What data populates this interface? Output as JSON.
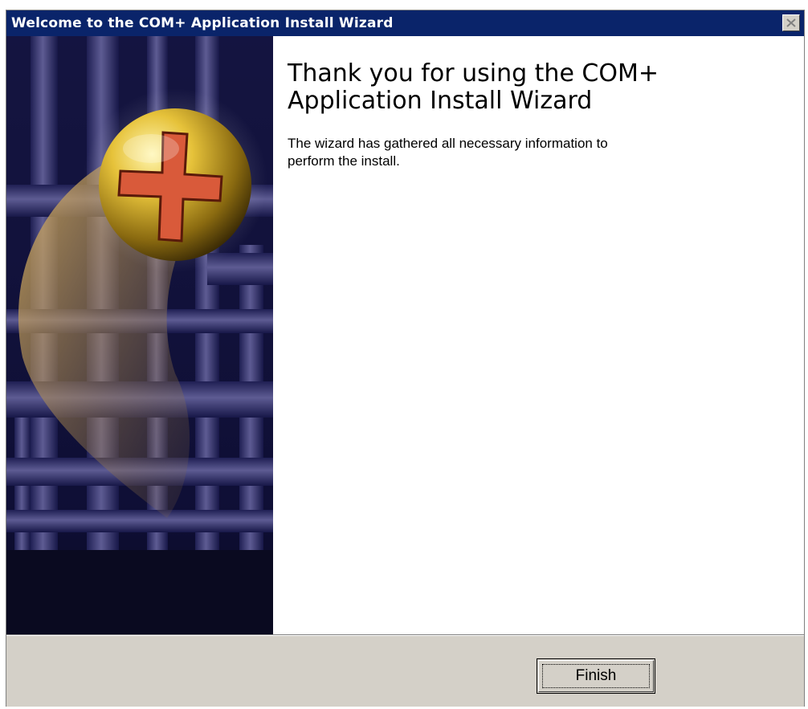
{
  "window": {
    "title": "Welcome to the COM+ Application Install Wizard",
    "titlebar_color": "#0a246a"
  },
  "icons": {
    "close": "close-icon",
    "banner": "com-plus-wizard-banner"
  },
  "content": {
    "heading_lines": [
      "Thank you for using the COM+",
      "Application Install Wizard"
    ],
    "description_lines": [
      "The wizard has gathered all necessary information to",
      "perform the install."
    ]
  },
  "footer": {
    "finish_label": "Finish"
  }
}
